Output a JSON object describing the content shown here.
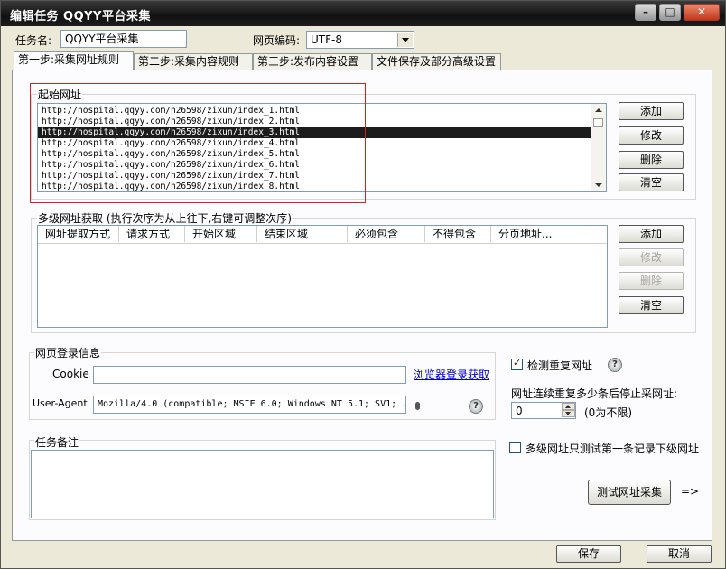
{
  "window": {
    "title": "编辑任务 QQYY平台采集",
    "min_glyph": "–",
    "max_glyph": "□",
    "close_glyph": "✕"
  },
  "task": {
    "name_label": "任务名:",
    "name_value": "QQYY平台采集",
    "encoding_label": "网页编码:",
    "encoding_value": "UTF-8"
  },
  "tabs": [
    {
      "label": "第一步:采集网址规则",
      "active": true
    },
    {
      "label": "第二步:采集内容规则",
      "active": false
    },
    {
      "label": "第三步:发布内容设置",
      "active": false
    },
    {
      "label": "文件保存及部分高级设置",
      "active": false
    }
  ],
  "start_urls": {
    "title": "起始网址",
    "items": [
      "http://hospital.qqyy.com/h26598/zixun/index_1.html",
      "http://hospital.qqyy.com/h26598/zixun/index_2.html",
      "http://hospital.qqyy.com/h26598/zixun/index_3.html",
      "http://hospital.qqyy.com/h26598/zixun/index_4.html",
      "http://hospital.qqyy.com/h26598/zixun/index_5.html",
      "http://hospital.qqyy.com/h26598/zixun/index_6.html",
      "http://hospital.qqyy.com/h26598/zixun/index_7.html",
      "http://hospital.qqyy.com/h26598/zixun/index_8.html"
    ],
    "selected_index": 2,
    "buttons": {
      "add": "添加",
      "edit": "修改",
      "delete": "删除",
      "clear": "清空"
    }
  },
  "multi_level": {
    "title": "多级网址获取 (执行次序为从上往下,右键可调整次序)",
    "columns": [
      "网址提取方式",
      "请求方式",
      "开始区域",
      "结束区域",
      "必须包含",
      "不得包含",
      "分页地址..."
    ],
    "buttons": {
      "add": "添加",
      "edit": "修改",
      "delete": "删除",
      "clear": "清空"
    }
  },
  "login": {
    "title": "网页登录信息",
    "cookie_label": "Cookie",
    "cookie_value": "",
    "browser_login_link": "浏览器登录获取",
    "ua_label": "User-Agent",
    "ua_value": "Mozilla/4.0 (compatible; MSIE 6.0; Windows NT 5.1; SV1; ."
  },
  "options": {
    "check_dup_label": "检测重复网址",
    "check_dup_checked": true,
    "stop_after_label": "网址连续重复多少条后停止采网址:",
    "stop_after_value": "0",
    "stop_after_hint": "(0为不限)",
    "only_first_label": "多级网址只测试第一条记录下级网址",
    "only_first_checked": false,
    "help_glyph": "?"
  },
  "notes": {
    "title": "任务备注",
    "value": ""
  },
  "test_button": "测试网址采集",
  "test_arrow": "=>",
  "footer": {
    "save": "保存",
    "cancel": "取消"
  }
}
